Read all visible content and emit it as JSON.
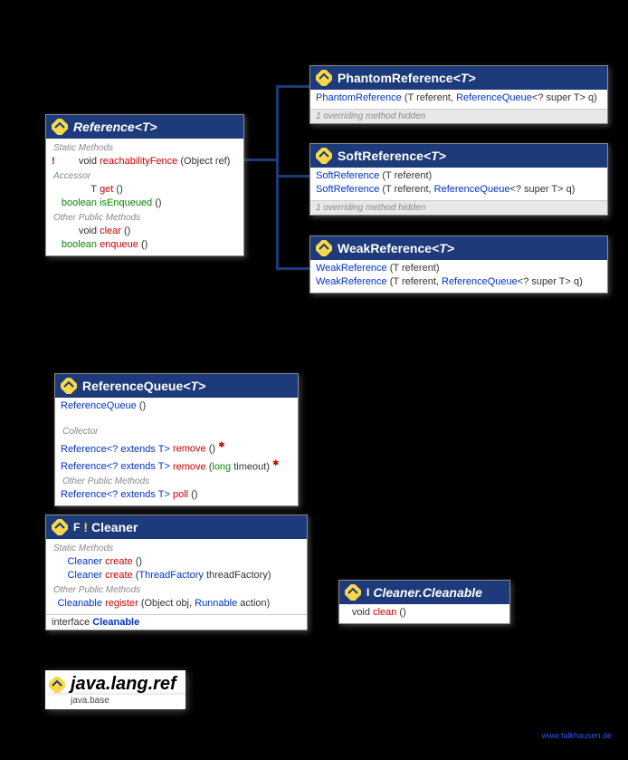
{
  "reference": {
    "title": "Reference",
    "generic": "<T>",
    "sec1": "Static Methods",
    "m1_bang": "!",
    "m1_ret": "void",
    "m1_name": "reachabilityFence",
    "m1_params": "(Object ref)",
    "sec2": "Accessor",
    "m2_ret": "T",
    "m2_name": "get",
    "m2_params": "()",
    "m3_ret": "boolean",
    "m3_name": "isEnqueued",
    "m3_params": "()",
    "sec3": "Other Public Methods",
    "m4_ret": "void",
    "m4_name": "clear",
    "m4_params": "()",
    "m5_ret": "boolean",
    "m5_name": "enqueue",
    "m5_params": "()"
  },
  "phantom": {
    "title": "PhantomReference",
    "generic": "<T>",
    "m1_name": "PhantomReference",
    "m1_p1": "(T referent, ",
    "m1_p2": "ReferenceQueue",
    "m1_p3": "<? super T> q)",
    "hidden": "1 overriding method hidden"
  },
  "soft": {
    "title": "SoftReference",
    "generic": "<T>",
    "m1_name": "SoftReference",
    "m1_params": "(T referent)",
    "m2_name": "SoftReference",
    "m2_p1": "(T referent, ",
    "m2_p2": "ReferenceQueue",
    "m2_p3": "<? super T> q)",
    "hidden": "1 overriding method hidden"
  },
  "weak": {
    "title": "WeakReference",
    "generic": "<T>",
    "m1_name": "WeakReference",
    "m1_params": "(T referent)",
    "m2_name": "WeakReference",
    "m2_p1": "(T referent, ",
    "m2_p2": "ReferenceQueue",
    "m2_p3": "<? super T> q)"
  },
  "queue": {
    "title": "ReferenceQueue",
    "generic": "<T>",
    "m1_name": "ReferenceQueue",
    "m1_params": "()",
    "sec1": "Collector",
    "m2_ret": "Reference<? extends T>",
    "m2_name": "remove",
    "m2_params": "()",
    "m2_throws": "✱",
    "m3_ret": "Reference<? extends T>",
    "m3_name": "remove",
    "m3_p1": "(",
    "m3_p2": "long",
    "m3_p3": " timeout)",
    "m3_throws": "✱",
    "sec2": "Other Public Methods",
    "m4_ret": "Reference<? extends T>",
    "m4_name": "poll",
    "m4_params": "()"
  },
  "cleaner": {
    "title": "Cleaner",
    "final": "!",
    "iface": "F",
    "sec1": "Static Methods",
    "m1_ret": "Cleaner",
    "m1_name": "create",
    "m1_params": "()",
    "m2_ret": "Cleaner",
    "m2_name": "create",
    "m2_p1": "(",
    "m2_p2": "ThreadFactory",
    "m2_p3": " threadFactory)",
    "sec2": "Other Public Methods",
    "m3_ret": "Cleanable",
    "m3_name": "register",
    "m3_p1": "(Object obj, ",
    "m3_p2": "Runnable",
    "m3_p3": " action)",
    "iface_label": "interface",
    "iface_name": "Cleanable"
  },
  "cleanable": {
    "title": "Cleaner.Cleanable",
    "iface": "I",
    "m1_ret": "void",
    "m1_name": "clean",
    "m1_params": "()"
  },
  "package": {
    "name": "java.lang.ref",
    "module": "java.base"
  },
  "footer": "www.falkhausen.de"
}
